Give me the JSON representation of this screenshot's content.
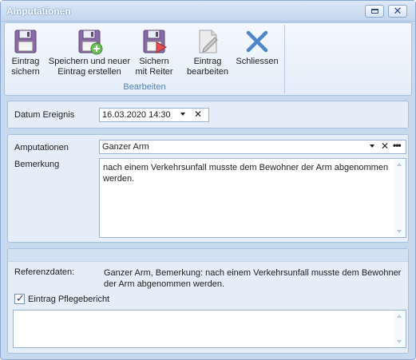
{
  "window": {
    "title": "Amputationen"
  },
  "ribbon": {
    "buttons": [
      {
        "label": "Eintrag\nsichern",
        "icon": "floppy-disk-icon"
      },
      {
        "label": "Speichern und neuer\nEintrag erstellen",
        "icon": "floppy-disk-add-icon"
      },
      {
        "label": "Sichern\nmit Reiter",
        "icon": "floppy-disk-tab-icon"
      },
      {
        "label": "Eintrag\nbearbeiten",
        "icon": "edit-document-icon"
      },
      {
        "label": "Schliessen",
        "icon": "close-x-icon"
      }
    ],
    "group_label": "Bearbeiten"
  },
  "event": {
    "label": "Datum Ereignis",
    "value": "16.03.2020 14:30"
  },
  "amputation": {
    "label": "Amputationen",
    "value": "Ganzer Arm",
    "remark_label": "Bemerkung",
    "remark": "nach einem Verkehrsunfall musste dem Bewohner der Arm abgenommen werden."
  },
  "reference": {
    "label": "Referenzdaten:",
    "value": "Ganzer Arm, Bemerkung: nach einem Verkehrsunfall musste dem Bewohner der Arm abgenommen werden.",
    "checkbox_label": "Eintrag Pflegebericht",
    "checkbox_checked": true,
    "note": ""
  },
  "colors": {
    "accent": "#5a7fb5",
    "panel": "#e4edf8",
    "border": "#a9c1e0"
  }
}
